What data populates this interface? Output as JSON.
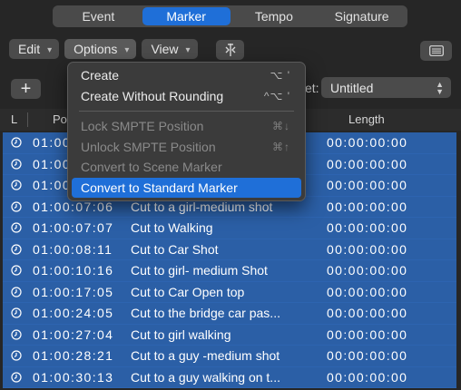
{
  "tabs": [
    {
      "label": "Event",
      "active": false
    },
    {
      "label": "Marker",
      "active": true
    },
    {
      "label": "Tempo",
      "active": false
    },
    {
      "label": "Signature",
      "active": false
    }
  ],
  "toolbar": {
    "edit_label": "Edit",
    "options_label": "Options",
    "view_label": "View"
  },
  "set_row": {
    "label": "et:",
    "value": "Untitled"
  },
  "table": {
    "headers": {
      "lock": "L",
      "position": "Po",
      "length": "Length"
    },
    "rows": [
      {
        "position": "01:00",
        "name": "",
        "length": "00:00:00:00"
      },
      {
        "position": "01:00",
        "name": "",
        "length": "00:00:00:00"
      },
      {
        "position": "01:00",
        "name": "",
        "length": "00:00:00:00"
      },
      {
        "position": "01:00:07:06",
        "name": "Cut to a girl-medium shot",
        "length": "00:00:00:00"
      },
      {
        "position": "01:00:07:07",
        "name": "Cut to Walking",
        "length": "00:00:00:00"
      },
      {
        "position": "01:00:08:11",
        "name": "Cut to Car Shot",
        "length": "00:00:00:00"
      },
      {
        "position": "01:00:10:16",
        "name": "Cut to girl- medium Shot",
        "length": "00:00:00:00"
      },
      {
        "position": "01:00:17:05",
        "name": "Cut to Car Open top",
        "length": "00:00:00:00"
      },
      {
        "position": "01:00:24:05",
        "name": "Cut to the bridge car pas...",
        "length": "00:00:00:00"
      },
      {
        "position": "01:00:27:04",
        "name": "Cut to girl walking",
        "length": "00:00:00:00"
      },
      {
        "position": "01:00:28:21",
        "name": "Cut to a guy -medium shot",
        "length": "00:00:00:00"
      },
      {
        "position": "01:00:30:13",
        "name": "Cut to a guy walking on t...",
        "length": "00:00:00:00"
      }
    ]
  },
  "menu": {
    "items": [
      {
        "label": "Create",
        "shortcut": "⌥ '"
      },
      {
        "label": "Create Without Rounding",
        "shortcut": "^⌥ '"
      },
      {
        "label": "Lock SMPTE Position",
        "shortcut": "⌘↓"
      },
      {
        "label": "Unlock SMPTE Position",
        "shortcut": "⌘↑"
      },
      {
        "label": "Convert to Scene Marker",
        "shortcut": ""
      },
      {
        "label": "Convert to Standard Marker",
        "shortcut": ""
      }
    ]
  },
  "icons": {
    "snap": "snap-icon",
    "list": "list-view-icon",
    "clock": "clock-icon"
  },
  "colors": {
    "accent": "#1f6fd8",
    "selection": "#2b5fa6"
  }
}
